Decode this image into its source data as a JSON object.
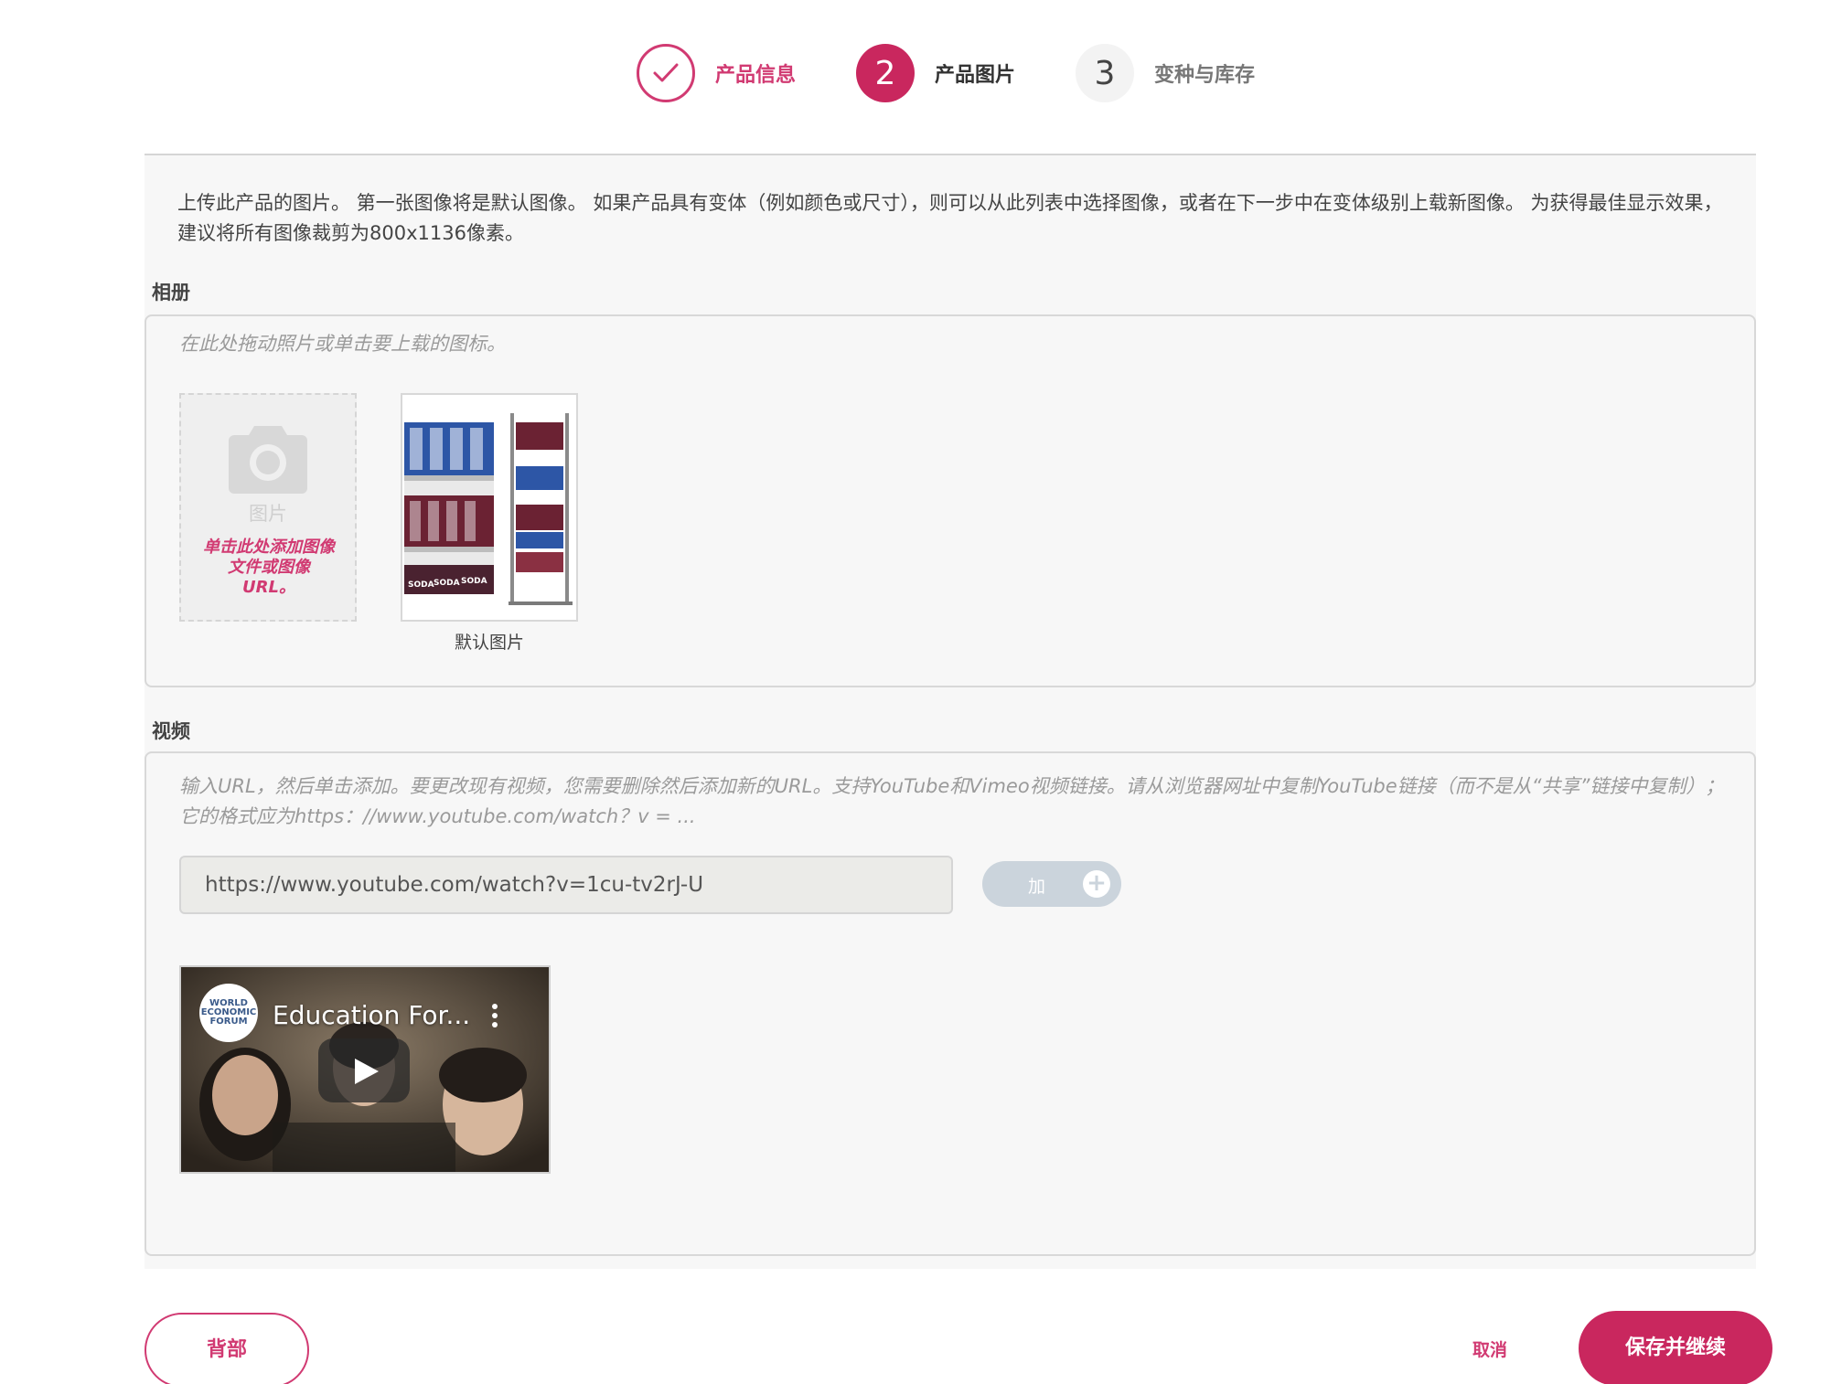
{
  "stepper": {
    "steps": [
      {
        "number": "",
        "label": "产品信息",
        "state": "completed"
      },
      {
        "number": "2",
        "label": "产品图片",
        "state": "active"
      },
      {
        "number": "3",
        "label": "变种与库存",
        "state": "pending"
      }
    ]
  },
  "intro_text": "上传此产品的图片。 第一张图像将是默认图像。 如果产品具有变体（例如颜色或尺寸），则可以从此列表中选择图像，或者在下一步中在变体级别上载新图像。 为获得最佳显示效果，建议将所有图像裁剪为800x1136像素。",
  "album": {
    "title": "相册",
    "hint": "在此处拖动照片或单击要上载的图标。",
    "upload_tile": {
      "label": "图片",
      "link": "单击此处添加图像文件或图像URL。"
    },
    "images": [
      {
        "caption": "默认图片",
        "text": "SODA"
      }
    ]
  },
  "video": {
    "title": "视频",
    "hint": "输入URL，然后单击添加。要更改现有视频，您需要删除然后添加新的URL。支持YouTube和Vimeo视频链接。请从浏览器网址中复制YouTube链接（而不是从“共享”链接中复制）；它的格式应为https：//www.youtube.com/watch？v = ...",
    "url_value": "https://www.youtube.com/watch?v=1cu-tv2rJ-U",
    "add_label": "加",
    "preview": {
      "title": "Education For...",
      "channel_logo_text": "WORLD ECONOMIC FORUM"
    }
  },
  "footer": {
    "back_label": "背部",
    "cancel_label": "取消",
    "save_label": "保存并继续"
  },
  "colors": {
    "accent": "#c9275e",
    "accent_text": "#d13a72",
    "panel_bg": "#f7f7f7",
    "add_button_bg": "#cbd4dc"
  }
}
